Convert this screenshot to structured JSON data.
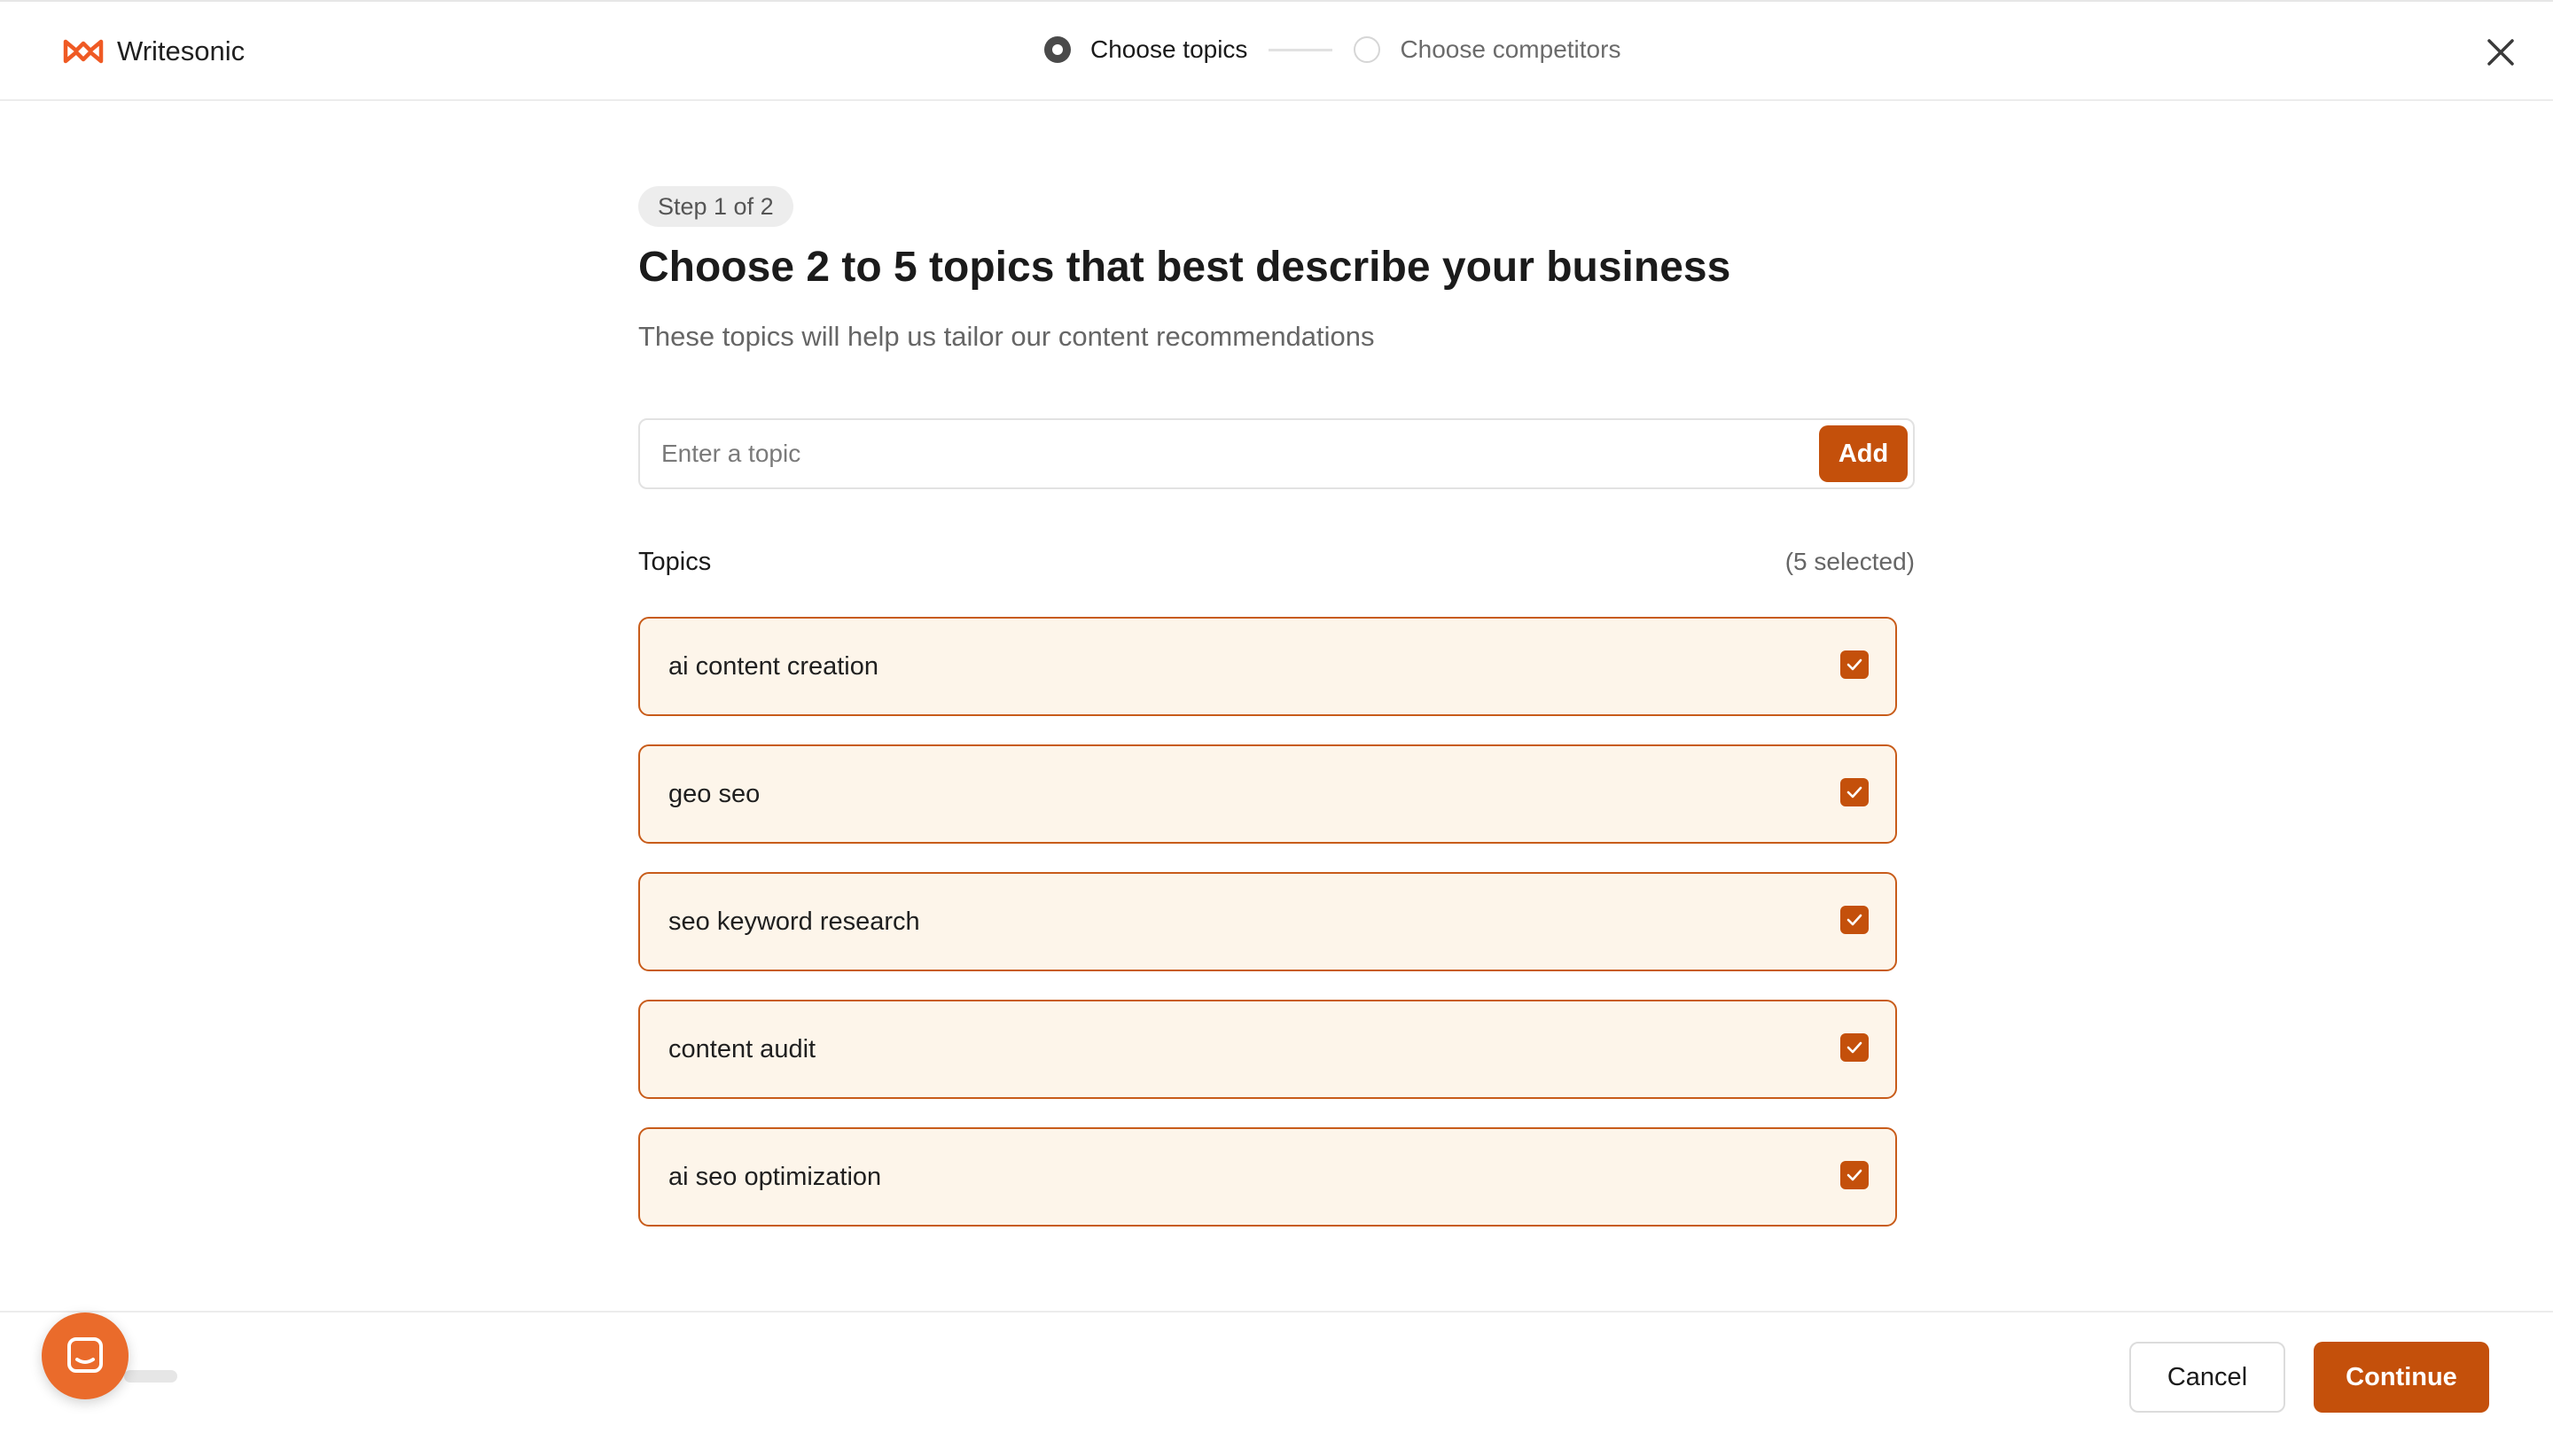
{
  "header": {
    "brand_name": "Writesonic",
    "brand_icon": "writesonic-logo-icon",
    "steps": [
      {
        "label": "Choose topics",
        "state": "active"
      },
      {
        "label": "Choose competitors",
        "state": "inactive"
      }
    ],
    "close_icon": "close-icon"
  },
  "main": {
    "step_pill": "Step 1 of 2",
    "title": "Choose 2 to 5 topics that best describe your business",
    "subtitle": "These topics will help us tailor our content recommendations",
    "topic_input": {
      "placeholder": "Enter a topic",
      "value": ""
    },
    "add_label": "Add",
    "topics_label": "Topics",
    "selected_count": "(5 selected)",
    "topics": [
      {
        "label": "ai content creation",
        "checked": true
      },
      {
        "label": "geo seo",
        "checked": true
      },
      {
        "label": "seo keyword research",
        "checked": true
      },
      {
        "label": "content audit",
        "checked": true
      },
      {
        "label": "ai seo optimization",
        "checked": true
      }
    ]
  },
  "footer": {
    "cancel_label": "Cancel",
    "continue_label": "Continue",
    "chat_icon": "chat-launcher-icon"
  },
  "colors": {
    "accent": "#c4500b",
    "topic_bg": "#fdf5ea",
    "topic_border": "#c85c1a",
    "launcher": "#ea6b2b"
  }
}
